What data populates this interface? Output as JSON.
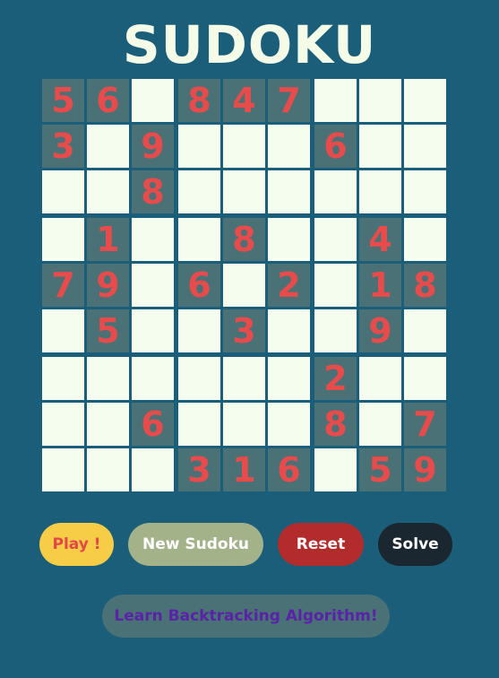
{
  "title": "SUDOKU",
  "board": {
    "rows": [
      [
        "5",
        "6",
        "",
        "8",
        "4",
        "7",
        "",
        "",
        ""
      ],
      [
        "3",
        "",
        "9",
        "",
        "",
        "",
        "6",
        "",
        ""
      ],
      [
        "",
        "",
        "8",
        "",
        "",
        "",
        "",
        "",
        ""
      ],
      [
        "",
        "1",
        "",
        "",
        "8",
        "",
        "",
        "4",
        ""
      ],
      [
        "7",
        "9",
        "",
        "6",
        "",
        "2",
        "",
        "1",
        "8"
      ],
      [
        "",
        "5",
        "",
        "",
        "3",
        "",
        "",
        "9",
        ""
      ],
      [
        "",
        "",
        "",
        "",
        "",
        "",
        "2",
        "",
        ""
      ],
      [
        "",
        "",
        "6",
        "",
        "",
        "",
        "8",
        "",
        "7"
      ],
      [
        "",
        "",
        "",
        "3",
        "1",
        "6",
        "",
        "5",
        "9"
      ]
    ]
  },
  "buttons": {
    "play": "Play !",
    "new_sudoku": "New Sudoku",
    "reset": "Reset",
    "solve": "Solve",
    "learn": "Learn Backtracking Algorithm!"
  },
  "colors": {
    "background": "#1b5e7a",
    "given_cell": "#4a7176",
    "empty_cell": "#f4fdee",
    "digit": "#e84b4b"
  }
}
